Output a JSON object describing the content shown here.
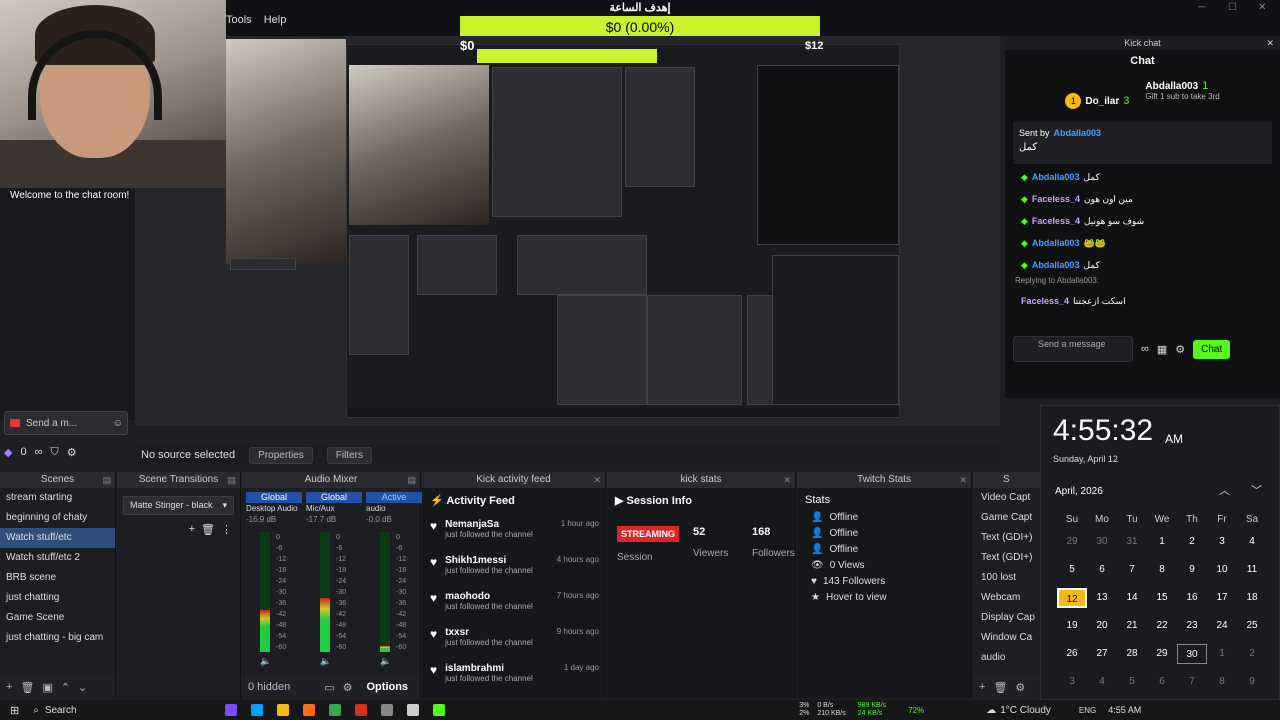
{
  "menu": [
    "Tools",
    "Help"
  ],
  "goal": {
    "title": "إهدف الساعة",
    "value_text": "$0 (0.00%)",
    "min": "$0",
    "max": "$12",
    "progress": 0
  },
  "webcam": {
    "welcome": "Welcome to the chat room!"
  },
  "left_send": {
    "placeholder": "Send a m..."
  },
  "left_status": {
    "count": "0"
  },
  "scene_bar": {
    "no_source": "No source selected",
    "properties": "Properties",
    "filters": "Filters"
  },
  "scenes": {
    "title": "Scenes",
    "items": [
      "stream starting",
      "beginning of chaty",
      "Watch stuff/etc",
      "Watch stuff/etc 2",
      "BRB scene",
      "just chatting",
      "Game Scene",
      "just chatting - big cam"
    ],
    "selected": 2
  },
  "transitions": {
    "title": "Scene Transitions",
    "value": "Matte Stinger - black"
  },
  "mixer": {
    "title": "Audio Mixer",
    "channels": [
      {
        "tag": "Global",
        "name": "Desktop Audio",
        "db": "-16.9 dB",
        "level": 0.35
      },
      {
        "tag": "Global",
        "name": "Mic/Aux",
        "db": "-17.7 dB",
        "level": 0.45
      },
      {
        "tag": "Active",
        "name": "audio",
        "db": "-0.0 dB",
        "level": 0.05
      }
    ],
    "scale": [
      "0",
      "-6",
      "-12",
      "-18",
      "-24",
      "-30",
      "-36",
      "-42",
      "-48",
      "-54",
      "-60"
    ],
    "hidden": "0 hidden",
    "options": "Options"
  },
  "activity": {
    "title": "Kick activity feed",
    "header": "Activity Feed",
    "items": [
      {
        "name": "NemanjaSa",
        "time": "1 hour ago",
        "sub": "just followed the channel"
      },
      {
        "name": "Shikh1messi",
        "time": "4 hours ago",
        "sub": "just followed the channel"
      },
      {
        "name": "maohodo",
        "time": "7 hours ago",
        "sub": "just followed the channel"
      },
      {
        "name": "txxsr",
        "time": "9 hours ago",
        "sub": "just followed the channel"
      },
      {
        "name": "islambrahmi",
        "time": "1 day ago",
        "sub": "just followed the channel"
      }
    ]
  },
  "kick_stats": {
    "title": "kick stats",
    "header": "Session Info",
    "badge": "STREAMING",
    "session": "Session",
    "viewers": "52",
    "viewers_label": "Viewers",
    "followers": "168",
    "followers_label": "Followers"
  },
  "twitch": {
    "title": "Twitch Stats",
    "header": "Stats",
    "rows": [
      "Offline",
      "Offline",
      "Offline",
      "0 Views",
      "143 Followers",
      "Hover to view"
    ]
  },
  "sources": {
    "items": [
      "Video Capt",
      "Game Capt",
      "Text (GDI+)",
      "Text (GDI+)",
      "100 lost",
      "Webcam",
      "Display Cap",
      "Window Ca",
      "audio"
    ]
  },
  "chat": {
    "window_title": "Kick chat",
    "header": "Chat",
    "top_gifters": [
      {
        "name": "Do_ilar",
        "count": "3"
      },
      {
        "name": "Abdalla003",
        "count": "1",
        "sub": "Gift 1 sub to take 3rd"
      }
    ],
    "pinned": {
      "label": "Sent by",
      "user": "Abdalla003",
      "text": "كمل"
    },
    "messages": [
      {
        "user": "Abdalla003",
        "text": "كمل",
        "color": "#49a0ff"
      },
      {
        "user": "Faceless_4",
        "text": "مين اون هون",
        "color": "#c9a0ff"
      },
      {
        "user": "Faceless_4",
        "text": "شوف سو هونيل",
        "color": "#c9a0ff"
      },
      {
        "user": "Abdalla003",
        "text": "🐸🐸",
        "color": "#49a0ff"
      },
      {
        "user": "Abdalla003",
        "text": "كمل",
        "color": "#49a0ff"
      }
    ],
    "reply_label": "Replying to Abdalla003:",
    "reply": {
      "user": "Faceless_4",
      "text": "اسكت ازعجتنا",
      "color": "#c9a0ff"
    },
    "send_placeholder": "Send a message",
    "send_button": "Chat"
  },
  "calendar": {
    "time": "4:55:32",
    "ampm": "AM",
    "date": "Sunday, April 12",
    "month": "April, 2026",
    "weekdays": [
      "Su",
      "Mo",
      "Tu",
      "We",
      "Th",
      "Fr",
      "Sa"
    ],
    "days": [
      "29",
      "30",
      "31",
      "1",
      "2",
      "3",
      "4",
      "5",
      "6",
      "7",
      "8",
      "9",
      "10",
      "11",
      "12",
      "13",
      "14",
      "15",
      "16",
      "17",
      "18",
      "19",
      "20",
      "21",
      "22",
      "23",
      "24",
      "25",
      "26",
      "27",
      "28",
      "29",
      "30",
      "1",
      "2",
      "3",
      "4",
      "5",
      "6",
      "7",
      "8",
      "9"
    ]
  },
  "taskbar": {
    "search": "Search",
    "weather": "1°C Cloudy",
    "lang": "ENG",
    "clock": "4:55 AM",
    "net_up": "0 B/s",
    "net_down": "210 KB/s",
    "cpu": "3%",
    "mem": "2%",
    "pct": "72%",
    "speed_up": "989 KB/s",
    "speed_down": "24 KB/s"
  },
  "colors": {
    "accent_green": "#c9f42b",
    "kick_green": "#53fc18",
    "selected": "#2f4f7a",
    "today": "#f5b918"
  }
}
